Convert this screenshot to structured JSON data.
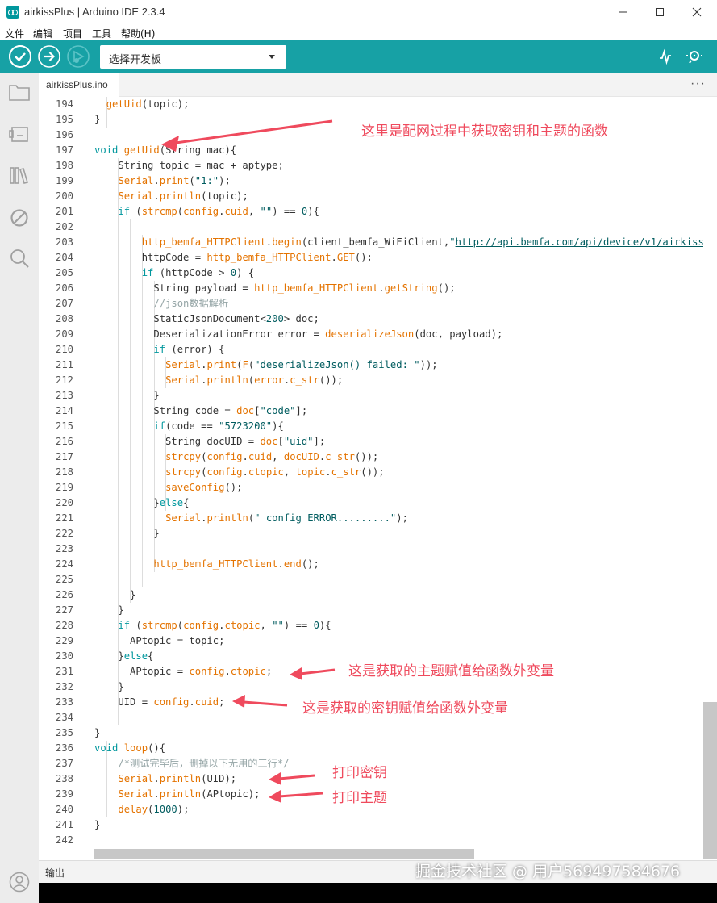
{
  "window": {
    "title": "airkissPlus | Arduino IDE 2.3.4",
    "minimize": "—",
    "maximize": "☐",
    "close": "✕"
  },
  "menu": [
    "文件",
    "编辑",
    "项目",
    "工具",
    "帮助(H)"
  ],
  "toolbar": {
    "board_select": "选择开发板"
  },
  "tab": {
    "file_name": "airkissPlus.ino",
    "more": "···"
  },
  "code_lines": [
    {
      "n": "194",
      "segs": [
        [
          "",
          "  "
        ],
        [
          "fn2",
          "getUid"
        ],
        [
          "",
          "(topic);"
        ]
      ]
    },
    {
      "n": "195",
      "segs": [
        [
          "",
          "}"
        ]
      ]
    },
    {
      "n": "196",
      "segs": []
    },
    {
      "n": "197",
      "segs": [
        [
          "kw",
          "void"
        ],
        [
          "",
          " "
        ],
        [
          "fn2",
          "getUid"
        ],
        [
          "",
          "(String mac){"
        ]
      ]
    },
    {
      "n": "198",
      "segs": [
        [
          "",
          "    String topic = mac + aptype;"
        ]
      ]
    },
    {
      "n": "199",
      "segs": [
        [
          "",
          "    "
        ],
        [
          "obj",
          "Serial"
        ],
        [
          "",
          "."
        ],
        [
          "fn2",
          "print"
        ],
        [
          "",
          "("
        ],
        [
          "str",
          "\"1:\""
        ],
        [
          "",
          ");"
        ]
      ]
    },
    {
      "n": "200",
      "segs": [
        [
          "",
          "    "
        ],
        [
          "obj",
          "Serial"
        ],
        [
          "",
          "."
        ],
        [
          "fn2",
          "println"
        ],
        [
          "",
          "(topic);"
        ]
      ]
    },
    {
      "n": "201",
      "segs": [
        [
          "",
          "    "
        ],
        [
          "kw",
          "if"
        ],
        [
          "",
          " ("
        ],
        [
          "fn2",
          "strcmp"
        ],
        [
          "",
          "("
        ],
        [
          "obj",
          "config"
        ],
        [
          "",
          "."
        ],
        [
          "obj",
          "cuid"
        ],
        [
          "",
          ", "
        ],
        [
          "str",
          "\"\""
        ],
        [
          "",
          ") == "
        ],
        [
          "num",
          "0"
        ],
        [
          "",
          "){"
        ]
      ]
    },
    {
      "n": "202",
      "segs": []
    },
    {
      "n": "203",
      "segs": [
        [
          "",
          "        "
        ],
        [
          "fn2",
          "http_bemfa_HTTPClient"
        ],
        [
          "",
          "."
        ],
        [
          "fn2",
          "begin"
        ],
        [
          "",
          "(client_bemfa_WiFiClient,"
        ],
        [
          "str",
          "\""
        ],
        [
          "url",
          "http://api.bemfa.com/api/device/v1/airkiss"
        ]
      ]
    },
    {
      "n": "204",
      "segs": [
        [
          "",
          "        httpCode = "
        ],
        [
          "fn2",
          "http_bemfa_HTTPClient"
        ],
        [
          "",
          "."
        ],
        [
          "fn2",
          "GET"
        ],
        [
          "",
          "();"
        ]
      ]
    },
    {
      "n": "205",
      "segs": [
        [
          "",
          "        "
        ],
        [
          "kw",
          "if"
        ],
        [
          "",
          " (httpCode > "
        ],
        [
          "num",
          "0"
        ],
        [
          "",
          ") {"
        ]
      ]
    },
    {
      "n": "206",
      "segs": [
        [
          "",
          "          String payload = "
        ],
        [
          "fn2",
          "http_bemfa_HTTPClient"
        ],
        [
          "",
          "."
        ],
        [
          "fn2",
          "getString"
        ],
        [
          "",
          "();"
        ]
      ]
    },
    {
      "n": "207",
      "segs": [
        [
          "",
          "          "
        ],
        [
          "cmt",
          "//json数据解析"
        ]
      ]
    },
    {
      "n": "208",
      "segs": [
        [
          "",
          "          StaticJsonDocument<"
        ],
        [
          "num",
          "200"
        ],
        [
          "",
          "> doc;"
        ]
      ]
    },
    {
      "n": "209",
      "segs": [
        [
          "",
          "          DeserializationError error = "
        ],
        [
          "fn2",
          "deserializeJson"
        ],
        [
          "",
          "(doc, payload);"
        ]
      ]
    },
    {
      "n": "210",
      "segs": [
        [
          "",
          "          "
        ],
        [
          "kw",
          "if"
        ],
        [
          "",
          " (error) {"
        ]
      ]
    },
    {
      "n": "211",
      "segs": [
        [
          "",
          "            "
        ],
        [
          "obj",
          "Serial"
        ],
        [
          "",
          "."
        ],
        [
          "fn2",
          "print"
        ],
        [
          "",
          "("
        ],
        [
          "fn2",
          "F"
        ],
        [
          "",
          "("
        ],
        [
          "str",
          "\"deserializeJson() failed: \""
        ],
        [
          "",
          "));"
        ]
      ]
    },
    {
      "n": "212",
      "segs": [
        [
          "",
          "            "
        ],
        [
          "obj",
          "Serial"
        ],
        [
          "",
          "."
        ],
        [
          "fn2",
          "println"
        ],
        [
          "",
          "("
        ],
        [
          "obj",
          "error"
        ],
        [
          "",
          "."
        ],
        [
          "fn2",
          "c_str"
        ],
        [
          "",
          "());"
        ]
      ]
    },
    {
      "n": "213",
      "segs": [
        [
          "",
          "          }"
        ]
      ]
    },
    {
      "n": "214",
      "segs": [
        [
          "",
          "          String code = "
        ],
        [
          "obj",
          "doc"
        ],
        [
          "",
          "["
        ],
        [
          "str",
          "\"code\""
        ],
        [
          "",
          "];"
        ]
      ]
    },
    {
      "n": "215",
      "segs": [
        [
          "",
          "          "
        ],
        [
          "kw",
          "if"
        ],
        [
          "",
          "(code == "
        ],
        [
          "str",
          "\"5723200\""
        ],
        [
          "",
          "){"
        ]
      ]
    },
    {
      "n": "216",
      "segs": [
        [
          "",
          "            String docUID = "
        ],
        [
          "obj",
          "doc"
        ],
        [
          "",
          "["
        ],
        [
          "str",
          "\"uid\""
        ],
        [
          "",
          "];"
        ]
      ]
    },
    {
      "n": "217",
      "segs": [
        [
          "",
          "            "
        ],
        [
          "fn2",
          "strcpy"
        ],
        [
          "",
          "("
        ],
        [
          "obj",
          "config"
        ],
        [
          "",
          "."
        ],
        [
          "obj",
          "cuid"
        ],
        [
          "",
          ", "
        ],
        [
          "obj",
          "docUID"
        ],
        [
          "",
          "."
        ],
        [
          "fn2",
          "c_str"
        ],
        [
          "",
          "());"
        ]
      ]
    },
    {
      "n": "218",
      "segs": [
        [
          "",
          "            "
        ],
        [
          "fn2",
          "strcpy"
        ],
        [
          "",
          "("
        ],
        [
          "obj",
          "config"
        ],
        [
          "",
          "."
        ],
        [
          "obj",
          "ctopic"
        ],
        [
          "",
          ", "
        ],
        [
          "obj",
          "topic"
        ],
        [
          "",
          "."
        ],
        [
          "fn2",
          "c_str"
        ],
        [
          "",
          "());"
        ]
      ]
    },
    {
      "n": "219",
      "segs": [
        [
          "",
          "            "
        ],
        [
          "fn2",
          "saveConfig"
        ],
        [
          "",
          "();"
        ]
      ]
    },
    {
      "n": "220",
      "segs": [
        [
          "",
          "          }"
        ],
        [
          "kw",
          "else"
        ],
        [
          "",
          "{"
        ]
      ]
    },
    {
      "n": "221",
      "segs": [
        [
          "",
          "            "
        ],
        [
          "obj",
          "Serial"
        ],
        [
          "",
          "."
        ],
        [
          "fn2",
          "println"
        ],
        [
          "",
          "("
        ],
        [
          "str",
          "\" config ERROR.........\""
        ],
        [
          "",
          ");"
        ]
      ]
    },
    {
      "n": "222",
      "segs": [
        [
          "",
          "          }"
        ]
      ]
    },
    {
      "n": "223",
      "segs": []
    },
    {
      "n": "224",
      "segs": [
        [
          "",
          "          "
        ],
        [
          "fn2",
          "http_bemfa_HTTPClient"
        ],
        [
          "",
          "."
        ],
        [
          "fn2",
          "end"
        ],
        [
          "",
          "();"
        ]
      ]
    },
    {
      "n": "225",
      "segs": []
    },
    {
      "n": "226",
      "segs": [
        [
          "",
          "      }"
        ]
      ]
    },
    {
      "n": "227",
      "segs": [
        [
          "",
          "    }"
        ]
      ]
    },
    {
      "n": "228",
      "segs": [
        [
          "",
          "    "
        ],
        [
          "kw",
          "if"
        ],
        [
          "",
          " ("
        ],
        [
          "fn2",
          "strcmp"
        ],
        [
          "",
          "("
        ],
        [
          "obj",
          "config"
        ],
        [
          "",
          "."
        ],
        [
          "obj",
          "ctopic"
        ],
        [
          "",
          ", "
        ],
        [
          "str",
          "\"\""
        ],
        [
          "",
          ") == "
        ],
        [
          "num",
          "0"
        ],
        [
          "",
          "){"
        ]
      ]
    },
    {
      "n": "229",
      "segs": [
        [
          "",
          "      APtopic = topic;"
        ]
      ]
    },
    {
      "n": "230",
      "segs": [
        [
          "",
          "    }"
        ],
        [
          "kw",
          "else"
        ],
        [
          "",
          "{"
        ]
      ]
    },
    {
      "n": "231",
      "segs": [
        [
          "",
          "      APtopic = "
        ],
        [
          "obj",
          "config"
        ],
        [
          "",
          "."
        ],
        [
          "obj",
          "ctopic"
        ],
        [
          "",
          ";"
        ]
      ]
    },
    {
      "n": "232",
      "segs": [
        [
          "",
          "    }"
        ]
      ]
    },
    {
      "n": "233",
      "segs": [
        [
          "",
          "    UID = "
        ],
        [
          "obj",
          "config"
        ],
        [
          "",
          "."
        ],
        [
          "obj",
          "cuid"
        ],
        [
          "",
          ";"
        ]
      ]
    },
    {
      "n": "234",
      "segs": []
    },
    {
      "n": "235",
      "segs": [
        [
          "",
          "}"
        ]
      ]
    },
    {
      "n": "236",
      "segs": [
        [
          "kw",
          "void"
        ],
        [
          "",
          " "
        ],
        [
          "fn2",
          "loop"
        ],
        [
          "",
          "(){"
        ]
      ]
    },
    {
      "n": "237",
      "segs": [
        [
          "",
          "    "
        ],
        [
          "cmt",
          "/*测试完毕后，删掉以下无用的三行*/"
        ]
      ]
    },
    {
      "n": "238",
      "segs": [
        [
          "",
          "    "
        ],
        [
          "obj",
          "Serial"
        ],
        [
          "",
          "."
        ],
        [
          "fn2",
          "println"
        ],
        [
          "",
          "(UID);"
        ]
      ]
    },
    {
      "n": "239",
      "segs": [
        [
          "",
          "    "
        ],
        [
          "obj",
          "Serial"
        ],
        [
          "",
          "."
        ],
        [
          "fn2",
          "println"
        ],
        [
          "",
          "(APtopic);"
        ]
      ]
    },
    {
      "n": "240",
      "segs": [
        [
          "",
          "    "
        ],
        [
          "fn2",
          "delay"
        ],
        [
          "",
          "("
        ],
        [
          "num",
          "1000"
        ],
        [
          "",
          ");"
        ]
      ]
    },
    {
      "n": "241",
      "segs": [
        [
          "",
          "}"
        ]
      ]
    },
    {
      "n": "242",
      "segs": []
    }
  ],
  "annotations": {
    "a1": "这里是配网过程中获取密钥和主题的函数",
    "a2": "这是获取的主题赋值给函数外变量",
    "a3": "这是获取的密钥赋值给函数外变量",
    "a4": "打印密钥",
    "a5": "打印主题"
  },
  "output_panel": {
    "label": "输出"
  },
  "watermark": "掘金技术社区 @ 用户5694975846​76",
  "colors": {
    "teal": "#17a1a5",
    "keyword": "#00979d",
    "function": "#e47300",
    "annotation": "#ef4a5d"
  }
}
